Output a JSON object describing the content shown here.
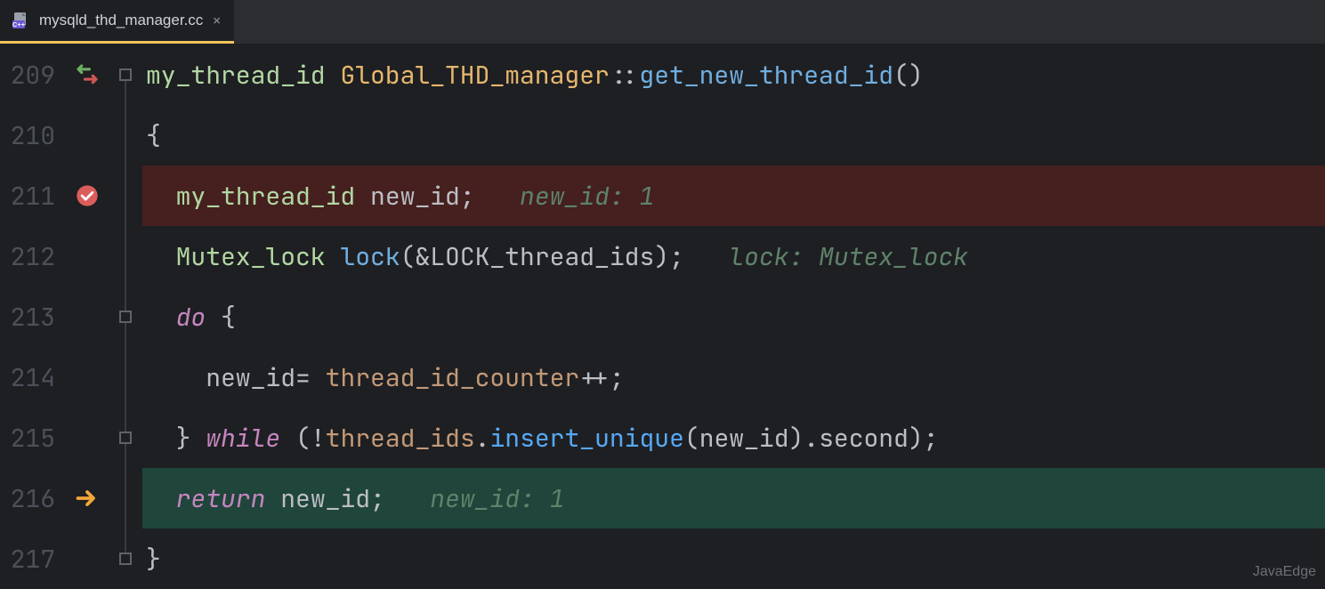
{
  "tab": {
    "filename": "mysqld_thd_manager.cc"
  },
  "lines": {
    "l209": {
      "no": "209",
      "type1": "my_thread_id ",
      "class": "Global_THD_manager",
      "sep": "::",
      "func": "get_new_thread_id",
      "paren": "()"
    },
    "l210": {
      "no": "210",
      "brace": "{"
    },
    "l211": {
      "no": "211",
      "indent": "  ",
      "type": "my_thread_id ",
      "var": "new_id",
      "semi": ";",
      "gap": "   ",
      "inlay": "new_id: 1"
    },
    "l212": {
      "no": "212",
      "indent": "  ",
      "type": "Mutex_lock ",
      "call": "lock",
      "open": "(",
      "amp": "&",
      "arg": "LOCK_thread_ids",
      "close": ")",
      "semi": ";",
      "gap": "   ",
      "inlay": "lock: Mutex_lock"
    },
    "l213": {
      "no": "213",
      "indent": "  ",
      "kw": "do",
      "rest": " {"
    },
    "l214": {
      "no": "214",
      "indent": "    ",
      "var": "new_id",
      "eq": "= ",
      "field": "thread_id_counter",
      "inc": "++;"
    },
    "l215": {
      "no": "215",
      "indent": "  ",
      "closebr": "} ",
      "kw": "while",
      "open": " (!",
      "field": "thread_ids",
      "dot1": ".",
      "method": "insert_unique",
      "open2": "(",
      "arg": "new_id",
      "close2": ").",
      "member": "second",
      "end": ");"
    },
    "l216": {
      "no": "216",
      "indent": "  ",
      "kw": "return",
      "sp": " ",
      "var": "new_id",
      "semi": ";",
      "gap": "   ",
      "inlay": "new_id: 1"
    },
    "l217": {
      "no": "217",
      "brace": "}"
    }
  },
  "watermark": "JavaEdge"
}
